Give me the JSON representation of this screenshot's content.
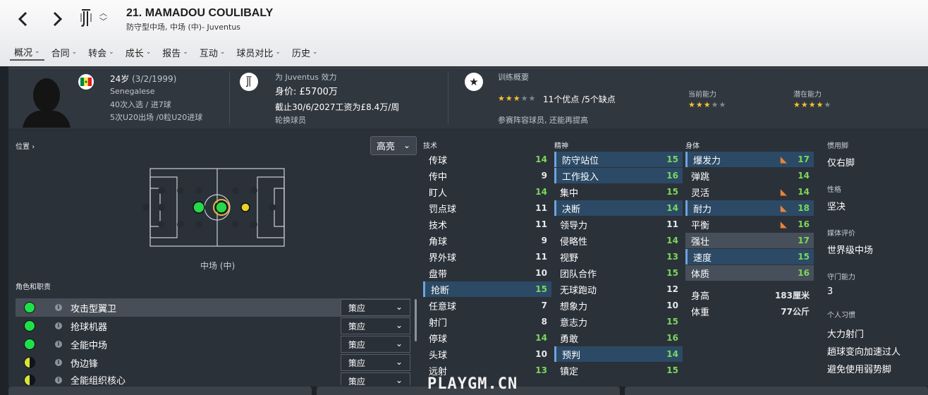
{
  "header": {
    "title": "21. MAMADOU COULIBALY",
    "subtitle": "防守型中场, 中场 (中)- Juventus",
    "tabs": [
      {
        "label": "概况"
      },
      {
        "label": "合同"
      },
      {
        "label": "转会"
      },
      {
        "label": "成长"
      },
      {
        "label": "报告"
      },
      {
        "label": "互动"
      },
      {
        "label": "球员对比"
      },
      {
        "label": "历史"
      }
    ]
  },
  "overview": {
    "age": "24岁",
    "dob": "(3/2/1999)",
    "nationality": "Senegalese",
    "caps": "40次入选 / 进7球",
    "u20": "5次U20出场 /0粒U20进球",
    "club_label": "为 Juventus 效力",
    "value": "身价: £5700万",
    "contract": "截止30/6/2027工资为£8.4万/周",
    "squad_status": "轮换球员",
    "training_title": "训练概要",
    "training_stars": 3,
    "training_summary": "11个优点 /5个缺点",
    "training_note": "参赛阵容球员, 还能再提高",
    "current_ability_label": "当前能力",
    "current_ability": 3,
    "potential_ability_label": "潜在能力",
    "potential_ability": 4
  },
  "position": {
    "label": "位置",
    "highlight_select": "高亮",
    "position_name": "中场 (中)"
  },
  "roles": {
    "label": "角色和职责",
    "items": [
      {
        "name": "攻击型翼卫",
        "duty": "策应",
        "dot": "full"
      },
      {
        "name": "抢球机器",
        "duty": "策应",
        "dot": "full"
      },
      {
        "name": "全能中场",
        "duty": "策应",
        "dot": "full"
      },
      {
        "name": "伪边锋",
        "duty": "策应",
        "dot": "half"
      },
      {
        "name": "全能组织核心",
        "duty": "策应",
        "dot": "half"
      }
    ]
  },
  "attributes": {
    "technical_label": "技术",
    "technical": [
      {
        "name": "传球",
        "value": 14,
        "hl": false
      },
      {
        "name": "传中",
        "value": 9,
        "hl": false
      },
      {
        "name": "盯人",
        "value": 14,
        "hl": false
      },
      {
        "name": "罚点球",
        "value": 11,
        "hl": false
      },
      {
        "name": "技术",
        "value": 11,
        "hl": false
      },
      {
        "name": "角球",
        "value": 9,
        "hl": false
      },
      {
        "name": "界外球",
        "value": 11,
        "hl": false
      },
      {
        "name": "盘带",
        "value": 10,
        "hl": false
      },
      {
        "name": "抢断",
        "value": 15,
        "hl": true
      },
      {
        "name": "任意球",
        "value": 7,
        "hl": false
      },
      {
        "name": "射门",
        "value": 8,
        "hl": false
      },
      {
        "name": "停球",
        "value": 14,
        "hl": false
      },
      {
        "name": "头球",
        "value": 10,
        "hl": false
      },
      {
        "name": "远射",
        "value": 13,
        "hl": false
      }
    ],
    "mental_label": "精神",
    "mental": [
      {
        "name": "防守站位",
        "value": 15,
        "hl": true
      },
      {
        "name": "工作投入",
        "value": 16,
        "hl": true
      },
      {
        "name": "集中",
        "value": 15,
        "hl": false
      },
      {
        "name": "决断",
        "value": 14,
        "hl": true
      },
      {
        "name": "领导力",
        "value": 11,
        "hl": false
      },
      {
        "name": "侵略性",
        "value": 14,
        "hl": false
      },
      {
        "name": "视野",
        "value": 13,
        "hl": false
      },
      {
        "name": "团队合作",
        "value": 15,
        "hl": false
      },
      {
        "name": "无球跑动",
        "value": 12,
        "hl": false
      },
      {
        "name": "想象力",
        "value": 10,
        "hl": false
      },
      {
        "name": "意志力",
        "value": 15,
        "hl": false
      },
      {
        "name": "勇敢",
        "value": 16,
        "hl": false
      },
      {
        "name": "预判",
        "value": 14,
        "hl": true
      },
      {
        "name": "镇定",
        "value": 15,
        "hl": false
      }
    ],
    "physical_label": "身体",
    "physical": [
      {
        "name": "爆发力",
        "value": 17,
        "hl": true,
        "arrow": true
      },
      {
        "name": "弹跳",
        "value": 14,
        "hl": false,
        "arrow": false
      },
      {
        "name": "灵活",
        "value": 14,
        "hl": false,
        "arrow": true
      },
      {
        "name": "耐力",
        "value": 18,
        "hl": true,
        "arrow": true
      },
      {
        "name": "平衡",
        "value": 16,
        "hl": false,
        "arrow": true
      },
      {
        "name": "强壮",
        "value": 17,
        "hl": false,
        "arrow": false,
        "box": true
      },
      {
        "name": "速度",
        "value": 15,
        "hl": true,
        "arrow": false,
        "box": true
      },
      {
        "name": "体质",
        "value": 16,
        "hl": false,
        "arrow": false,
        "box": true
      }
    ],
    "height_label": "身高",
    "height": "183厘米",
    "weight_label": "体重",
    "weight": "77公斤"
  },
  "info": {
    "foot_label": "惯用脚",
    "foot": "仅右脚",
    "personality_label": "性格",
    "personality": "坚决",
    "media_label": "媒体评价",
    "media": "世界级中场",
    "gk_label": "守门能力",
    "gk": "3",
    "habits_label": "个人习惯",
    "habits": [
      "大力射门",
      "趟球变向加速过人",
      "避免使用弱势脚"
    ]
  },
  "watermark": "PLAYGM.CN"
}
